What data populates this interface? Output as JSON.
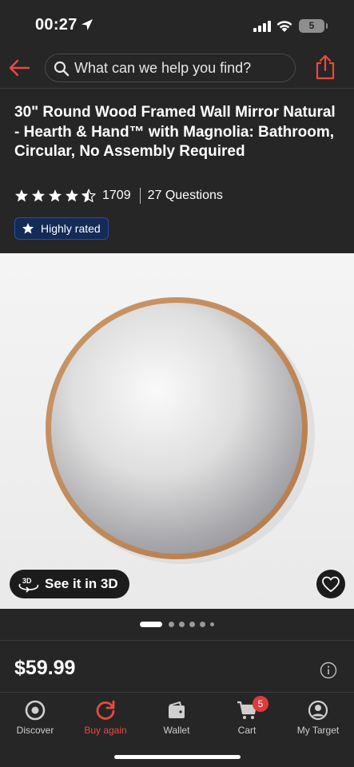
{
  "status_bar": {
    "time": "00:27",
    "battery": "5",
    "icons": [
      "location-arrow-icon",
      "signal-icon",
      "wifi-icon",
      "battery-icon"
    ]
  },
  "header": {
    "search_placeholder": "What can we help you find?",
    "icons": [
      "back-arrow-icon",
      "search-icon",
      "share-icon"
    ],
    "accent_color": "#e84a3e"
  },
  "product": {
    "title": "30\" Round Wood Framed Wall Mirror Natural - Hearth & Hand™ with Magnolia: Bathroom, Circular, No Assembly Required",
    "rating": 4.5,
    "review_count": "1709",
    "questions": "27 Questions",
    "badge": "Highly rated",
    "see_in_3d": "See it in 3D",
    "price": "$59.99"
  },
  "carousel": {
    "active_index": 0,
    "total": 6
  },
  "tabbar": {
    "items": [
      {
        "label": "Discover",
        "icon": "target-icon",
        "active": false
      },
      {
        "label": "Buy again",
        "icon": "refresh-icon",
        "active": true
      },
      {
        "label": "Wallet",
        "icon": "wallet-icon",
        "active": false
      },
      {
        "label": "Cart",
        "icon": "cart-icon",
        "active": false
      },
      {
        "label": "My Target",
        "icon": "profile-icon",
        "active": false
      }
    ],
    "cart_count": "5"
  }
}
